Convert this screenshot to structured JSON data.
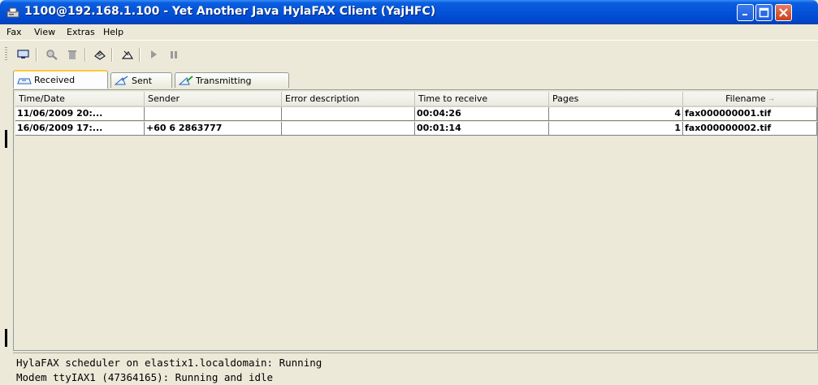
{
  "window": {
    "title": "1100@192.168.1.100 - Yet Another Java HylaFAX Client (YajHFC)"
  },
  "menu": [
    "Fax",
    "View",
    "Extras",
    "Help"
  ],
  "toolbar": {
    "buttons": [
      "view-fax",
      "search",
      "delete",
      "resend",
      "forward",
      "play",
      "pause"
    ]
  },
  "tabs": [
    {
      "label": "Received",
      "active": true
    },
    {
      "label": "Sent",
      "active": false
    },
    {
      "label": "Transmitting",
      "active": false
    }
  ],
  "table": {
    "columns": [
      "Time/Date",
      "Sender",
      "Error description",
      "Time to receive",
      "Pages",
      "Filename"
    ],
    "sort_indicator": "→",
    "rows": [
      {
        "time_date": "11/06/2009 20:...",
        "sender": "",
        "error": "",
        "time_to_receive": "00:04:26",
        "pages": "4",
        "filename": "fax000000001.tif"
      },
      {
        "time_date": "16/06/2009 17:...",
        "sender": "+60 6 2863777",
        "error": "",
        "time_to_receive": "00:01:14",
        "pages": "1",
        "filename": "fax000000002.tif"
      }
    ]
  },
  "status": {
    "line1": "HylaFAX scheduler on elastix1.localdomain: Running",
    "line2": "Modem ttyIAX1 (47364165): Running and idle"
  },
  "colors": {
    "titlebar": "#0553d8",
    "window_bg": "#ece9d8",
    "active_tab_accent": "#ffc83c"
  }
}
